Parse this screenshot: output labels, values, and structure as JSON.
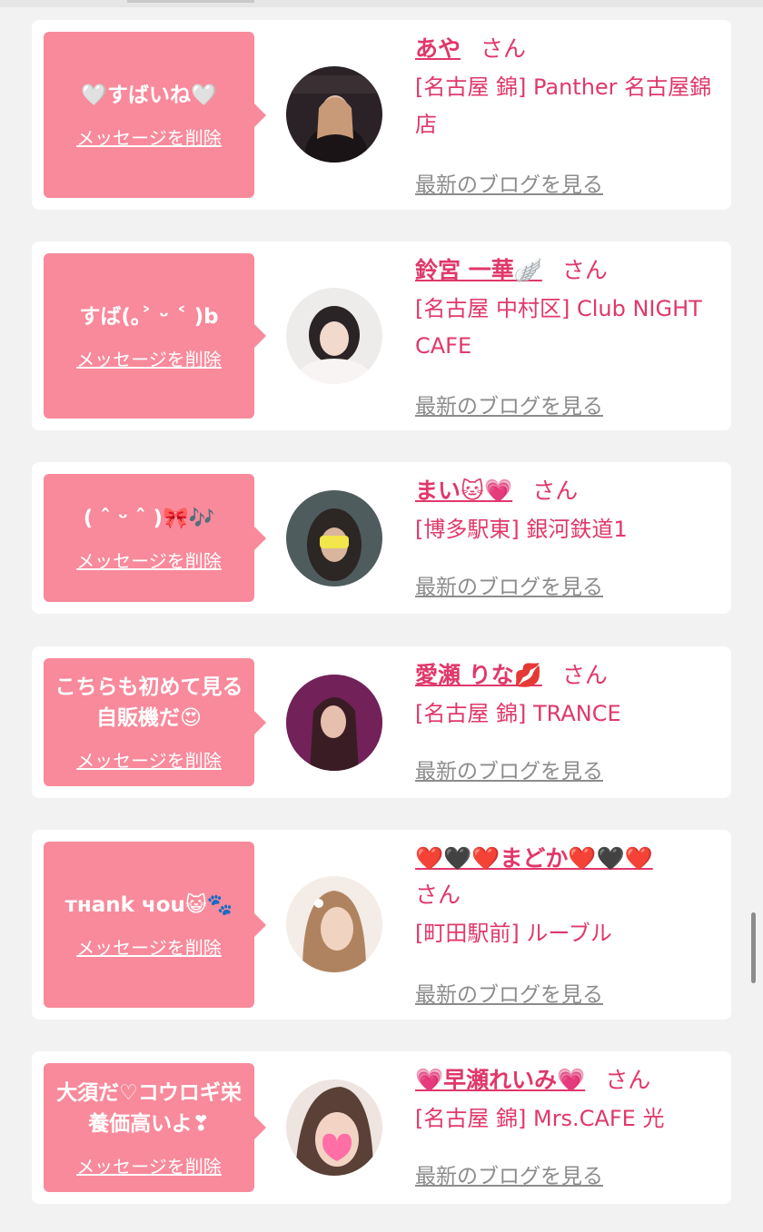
{
  "colors": {
    "page_bg": "#f2f2f2",
    "card_bg": "#ffffff",
    "bubble_bg": "#f88a9b",
    "name_pink": "#e0386a",
    "blog_gray": "#8c8c8c"
  },
  "delete_label": "メッセージを削除",
  "blog_label": "最新のブログを見る",
  "san_label": "さん",
  "messages": [
    {
      "text": "🤍すばいね🤍",
      "name": "あや",
      "shop": "[名古屋 錦] Panther 名古屋錦店",
      "avatar_icon": "avatar-photo-icon"
    },
    {
      "text": "すば(｡˃ ᵕ ˂ )b",
      "name": "鈴宮 一華🪽",
      "shop": "[名古屋 中村区] Club NIGHT CAFE",
      "avatar_icon": "avatar-photo-icon"
    },
    {
      "text": "( ˆ ᵕ ˆ )🎀🎶",
      "name": "まい🐱💗",
      "shop": "[博多駅東] 銀河鉄道1",
      "avatar_icon": "avatar-photo-icon"
    },
    {
      "text": "こちらも初めて見る自販機だ😍",
      "name": "愛瀬 りな💋",
      "shop": "[名古屋 錦] TRANCE",
      "avatar_icon": "avatar-photo-icon"
    },
    {
      "text": "тнank чou😺🐾",
      "name": "❤️🖤❤️まどか❤️🖤❤️",
      "shop": "[町田駅前] ルーブル",
      "avatar_icon": "avatar-photo-icon"
    },
    {
      "text": "大須だ♡コウロギ栄養価高いよ❣",
      "name": "💗早瀬れいみ💗",
      "shop": "[名古屋 錦] Mrs.CAFE 光",
      "avatar_icon": "avatar-photo-icon"
    }
  ]
}
